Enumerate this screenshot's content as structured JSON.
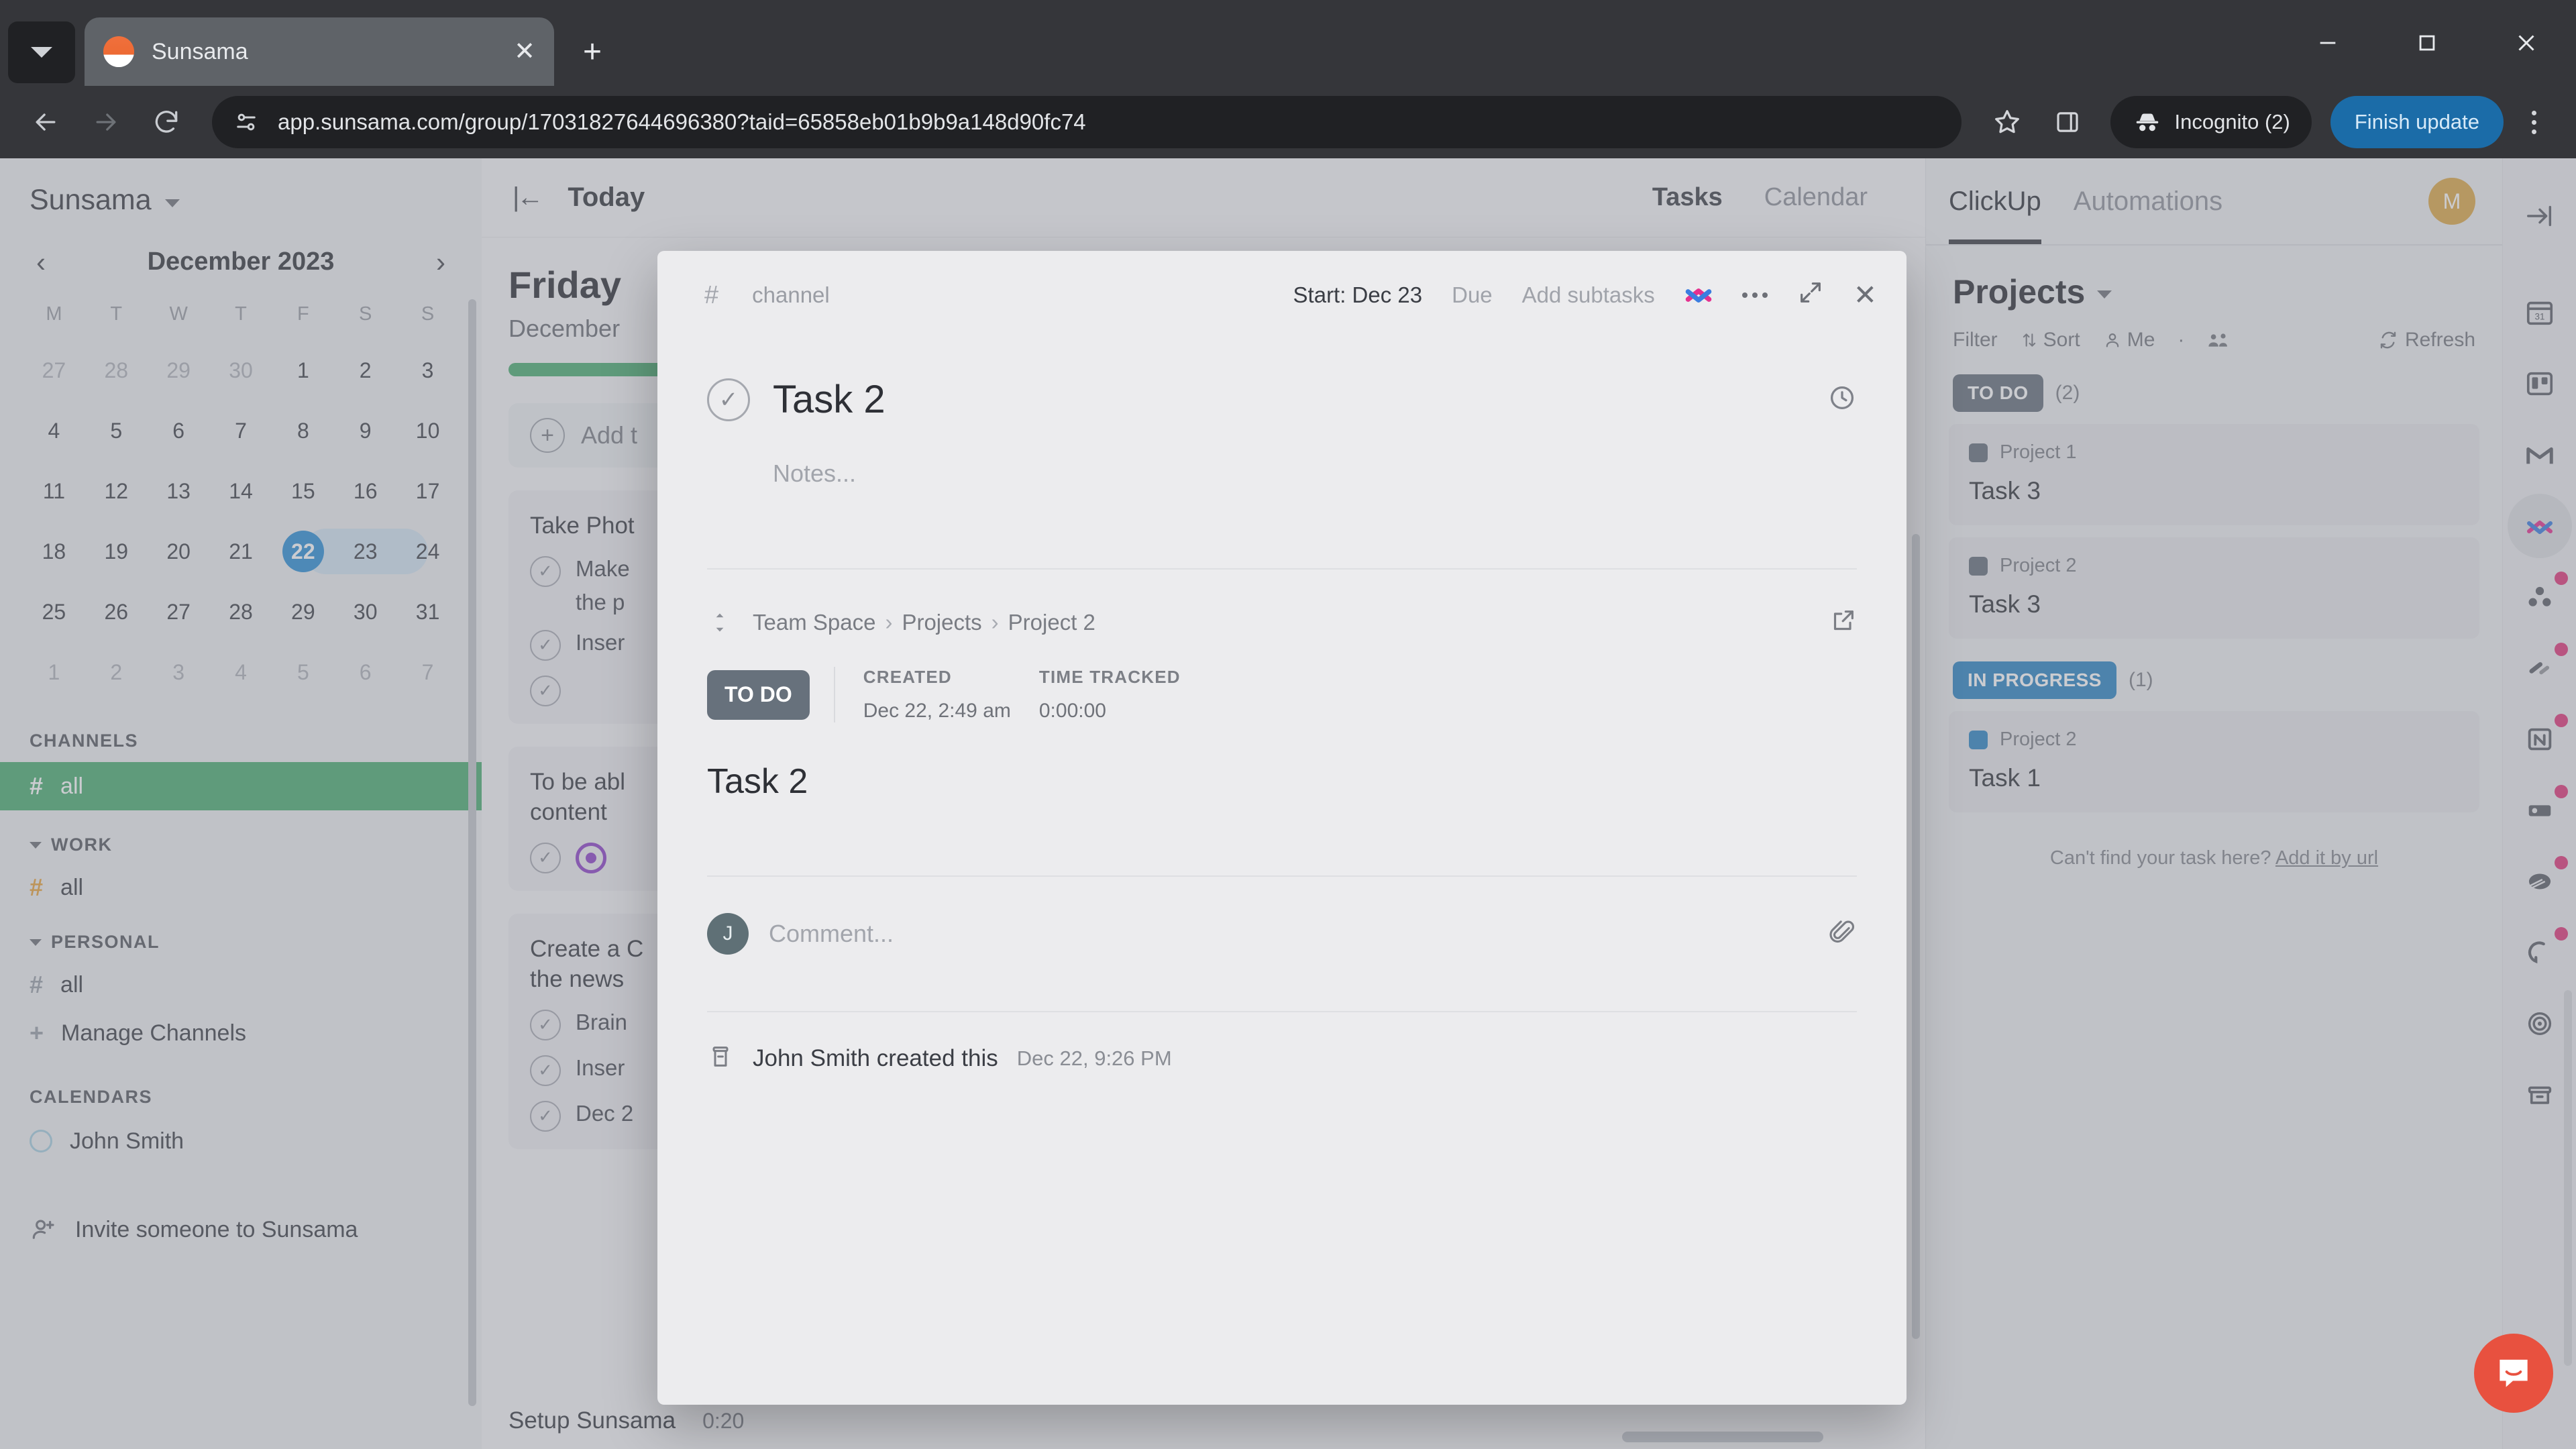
{
  "browser": {
    "tab_title": "Sunsama",
    "url": "app.sunsama.com/group/17031827644696380?taid=65858eb01b9b9a148d90fc74",
    "incognito_label": "Incognito (2)",
    "finish_update_label": "Finish update"
  },
  "sidebar": {
    "brand": "Sunsama",
    "calendar": {
      "month": "December 2023",
      "prev": "‹",
      "next": "›",
      "dow": [
        "M",
        "T",
        "W",
        "T",
        "F",
        "S",
        "S"
      ],
      "weeks": [
        [
          {
            "d": "27",
            "muted": true
          },
          {
            "d": "28",
            "muted": true
          },
          {
            "d": "29",
            "muted": true
          },
          {
            "d": "30",
            "muted": true
          },
          {
            "d": "1"
          },
          {
            "d": "2"
          },
          {
            "d": "3"
          }
        ],
        [
          {
            "d": "4"
          },
          {
            "d": "5"
          },
          {
            "d": "6"
          },
          {
            "d": "7"
          },
          {
            "d": "8"
          },
          {
            "d": "9"
          },
          {
            "d": "10"
          }
        ],
        [
          {
            "d": "11"
          },
          {
            "d": "12"
          },
          {
            "d": "13"
          },
          {
            "d": "14"
          },
          {
            "d": "15"
          },
          {
            "d": "16"
          },
          {
            "d": "17"
          }
        ],
        [
          {
            "d": "18"
          },
          {
            "d": "19"
          },
          {
            "d": "20"
          },
          {
            "d": "21"
          },
          {
            "d": "22",
            "sel": true,
            "range": "start"
          },
          {
            "d": "23",
            "range": "mid"
          },
          {
            "d": "24",
            "range": "end"
          }
        ],
        [
          {
            "d": "25"
          },
          {
            "d": "26"
          },
          {
            "d": "27"
          },
          {
            "d": "28"
          },
          {
            "d": "29"
          },
          {
            "d": "30"
          },
          {
            "d": "31"
          }
        ],
        [
          {
            "d": "1",
            "muted": true
          },
          {
            "d": "2",
            "muted": true
          },
          {
            "d": "3",
            "muted": true
          },
          {
            "d": "4",
            "muted": true
          },
          {
            "d": "5",
            "muted": true
          },
          {
            "d": "6",
            "muted": true
          },
          {
            "d": "7",
            "muted": true
          }
        ]
      ]
    },
    "channels_header": "CHANNELS",
    "channel_all": "all",
    "work_header": "WORK",
    "work_all": "all",
    "personal_header": "PERSONAL",
    "personal_all": "all",
    "manage_channels": "Manage Channels",
    "calendars_header": "CALENDARS",
    "calendar_person": "John Smith",
    "invite": "Invite someone to Sunsama"
  },
  "middle": {
    "today_label": "Today",
    "tabs": [
      {
        "label": "Tasks",
        "active": true
      },
      {
        "label": "Calendar",
        "active": false
      }
    ],
    "day_name": "Friday",
    "day_date": "December",
    "add_task": "Add t",
    "tasks": [
      {
        "title": "Take Phot",
        "subtasks": [
          {
            "label": "Make"
          },
          {
            "label": "the p",
            "continuation": true
          },
          {
            "label": "Inser"
          },
          {
            "label": ""
          }
        ]
      },
      {
        "title": "To be abl",
        "title2": "content",
        "subtasks": [
          {
            "label": "",
            "icon": "target"
          }
        ]
      },
      {
        "title": "Create a C",
        "title2": "the news",
        "subtasks": [
          {
            "label": "Brain"
          },
          {
            "label": "Inser"
          },
          {
            "label": "Dec 2"
          }
        ]
      }
    ],
    "bottom_task": "Setup Sunsama",
    "bottom_time": "0:20"
  },
  "modal": {
    "hash": "#",
    "channel": "channel",
    "start": "Start: Dec 23",
    "due": "Due",
    "add_subtasks": "Add subtasks",
    "task_title": "Task 2",
    "notes_placeholder": "Notes...",
    "integration": {
      "breadcrumb": [
        "Team Space",
        "Projects",
        "Project 2"
      ],
      "status": "TO DO",
      "created_label": "CREATED",
      "created_value": "Dec 22, 2:49 am",
      "time_tracked_label": "TIME TRACKED",
      "time_tracked_value": "0:00:00",
      "task_title": "Task 2"
    },
    "comment_avatar": "J",
    "comment_placeholder": "Comment...",
    "activity_text": "John Smith created this",
    "activity_time": "Dec 22, 9:26 PM"
  },
  "rightpanel": {
    "tabs": [
      {
        "label": "ClickUp",
        "active": true
      },
      {
        "label": "Automations",
        "active": false
      }
    ],
    "avatar": "M",
    "title": "Projects",
    "controls": {
      "filter": "Filter",
      "sort": "Sort",
      "me": "Me",
      "dot": "·",
      "refresh": "Refresh"
    },
    "groups": [
      {
        "status": "TO DO",
        "status_color": "#67717c",
        "count": "(2)",
        "cards": [
          {
            "project": "Project 1",
            "project_color": "#67717c",
            "task": "Task 3"
          },
          {
            "project": "Project 2",
            "project_color": "#67717c",
            "task": "Task 3"
          }
        ]
      },
      {
        "status": "IN PROGRESS",
        "status_color": "#2d86c4",
        "count": "(1)",
        "cards": [
          {
            "project": "Project 2",
            "project_color": "#2d86c4",
            "task": "Task 1"
          }
        ]
      }
    ],
    "footnote_text": "Can't find your task here?",
    "footnote_link": "Add it by url"
  },
  "rail": {
    "icons": [
      {
        "name": "collapse-panel-icon",
        "dot": false
      },
      {
        "name": "google-calendar-icon",
        "dot": false
      },
      {
        "name": "trello-icon",
        "dot": false
      },
      {
        "name": "gmail-icon",
        "dot": false
      },
      {
        "name": "clickup-icon",
        "dot": false,
        "highlight": true
      },
      {
        "name": "asana-icon",
        "dot": true
      },
      {
        "name": "linear-icon",
        "dot": true
      },
      {
        "name": "notion-icon",
        "dot": true
      },
      {
        "name": "jira-icon",
        "dot": true
      },
      {
        "name": "asana-alt-icon",
        "dot": true
      },
      {
        "name": "github-icon",
        "dot": true
      },
      {
        "name": "todoist-icon",
        "dot": false
      },
      {
        "name": "archive-icon",
        "dot": false
      }
    ]
  },
  "colors": {
    "accent_green": "#4cae72",
    "accent_blue": "#2d8fd5",
    "chip_todo": "#67717c",
    "chip_progress": "#2d86c4",
    "intercom": "#e8513f",
    "update_button": "#1b6ca8"
  }
}
